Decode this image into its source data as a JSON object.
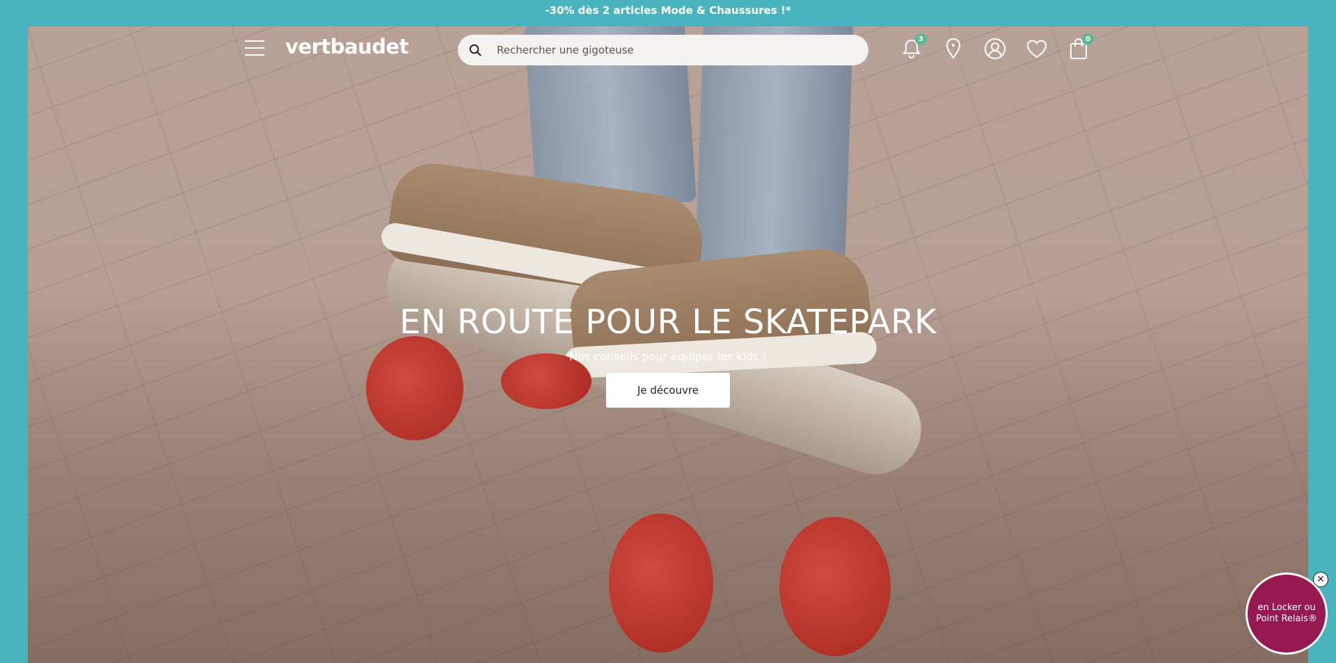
{
  "promo": {
    "text": "-30% dès 2 articles Mode & Chaussures !*"
  },
  "header": {
    "logo": "vertbaudet",
    "search_placeholder": "Rechercher une gigoteuse",
    "notifications_count": "3",
    "cart_count": "0",
    "icons": [
      "menu-icon",
      "search-icon",
      "bell-icon",
      "location-pin-icon",
      "user-icon",
      "heart-icon",
      "bag-icon"
    ]
  },
  "hero": {
    "title": "EN ROUTE POUR LE SKATEPARK",
    "subtitle": "Nos conseils pour équiper les kids !",
    "cta": "Je découvre"
  },
  "locker": {
    "text_line1": "en Locker ou",
    "text_line2": "Point Relais®"
  },
  "colors": {
    "brand": "#4ab4be",
    "badge": "#5cb891",
    "locker": "#96194f"
  }
}
